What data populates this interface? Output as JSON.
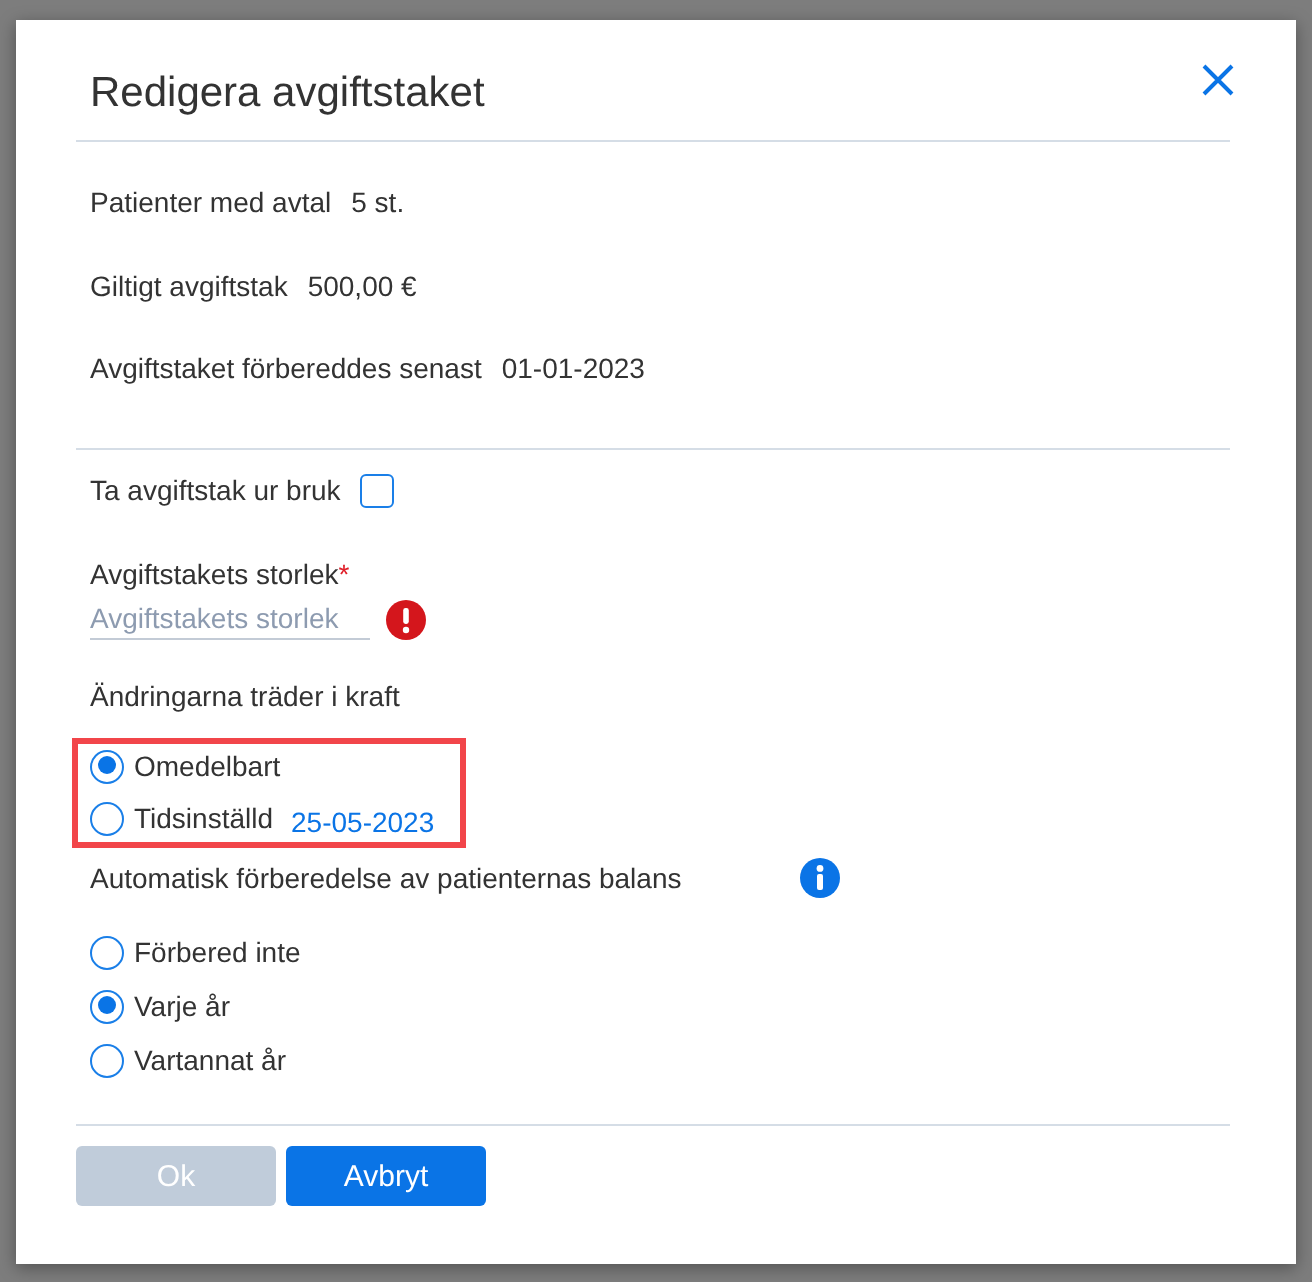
{
  "dialog": {
    "title": "Redigera avgiftstaket"
  },
  "info_rows": [
    {
      "label": "Patienter med avtal",
      "value": "5 st."
    },
    {
      "label": "Giltigt avgiftstak",
      "value": "500,00 €"
    },
    {
      "label": "Avgiftstaket förbereddes senast",
      "value": "01-01-2023"
    }
  ],
  "deactivate": {
    "label": "Ta avgiftstak ur bruk",
    "checked": false
  },
  "size_field": {
    "label": "Avgiftstakets storlek",
    "required_mark": "*",
    "placeholder": "Avgiftstakets storlek",
    "error": true
  },
  "effective": {
    "label": "Ändringarna träder i kraft",
    "highlighted": true,
    "options": [
      {
        "label": "Omedelbart",
        "selected": true
      },
      {
        "label": "Tidsinställd",
        "selected": false,
        "date": "25-05-2023"
      }
    ]
  },
  "auto_prepare": {
    "label": "Automatisk förberedelse av patienternas balans",
    "options": [
      {
        "label": "Förbered inte",
        "selected": false
      },
      {
        "label": "Varje år",
        "selected": true
      },
      {
        "label": "Vartannat år",
        "selected": false
      }
    ]
  },
  "buttons": [
    {
      "label": "Ok",
      "disabled": true
    },
    {
      "label": "Avbryt",
      "disabled": false
    }
  ]
}
